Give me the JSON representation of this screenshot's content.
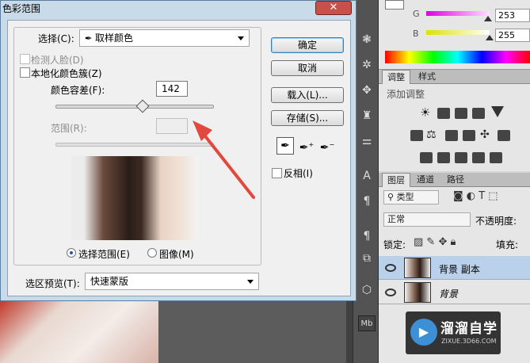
{
  "dialog": {
    "title": "色彩范围",
    "close_glyph": "✕",
    "select_label": "选择(C):",
    "select_value": "取样颜色",
    "detect_faces_label": "检测人脸(D)",
    "localized_label": "本地化颜色簇(Z)",
    "fuzziness_label": "颜色容差(F):",
    "fuzziness_value": "142",
    "fuzziness_level": 0.55,
    "range_label": "范围(R):",
    "radio_selection": "选择范围(E)",
    "radio_image": "图像(M)",
    "preview_label": "选区预览(T):",
    "preview_value": "快速蒙版",
    "invert_label": "反相(I)",
    "buttons": {
      "ok": "确定",
      "cancel": "取消",
      "load": "载入(L)...",
      "save": "存储(S)..."
    }
  },
  "color_panel": {
    "g_label": "G",
    "g_value": "253",
    "b_label": "B",
    "b_value": "255"
  },
  "adjust_panel": {
    "tab_adjust": "调整",
    "tab_styles": "样式",
    "add_adjustment": "添加调整"
  },
  "layers_panel": {
    "tab_layers": "图层",
    "tab_channels": "通道",
    "tab_paths": "路径",
    "kind_label": "类型",
    "blend_mode": "正常",
    "opacity_label": "不透明度:",
    "lock_label": "锁定:",
    "fill_label": "填充:",
    "layers": [
      {
        "name": "背景 副本",
        "selected": true
      },
      {
        "name": "背景",
        "selected": false
      }
    ]
  },
  "watermark": {
    "title": "溜溜自学",
    "url": "ZIXUE.3D66.COM"
  },
  "colors": {
    "dialog_frame": "#c9dbe9",
    "close_button": "#c7504b",
    "selected_layer": "#b9d1ea",
    "arrow": "#e2483d"
  }
}
